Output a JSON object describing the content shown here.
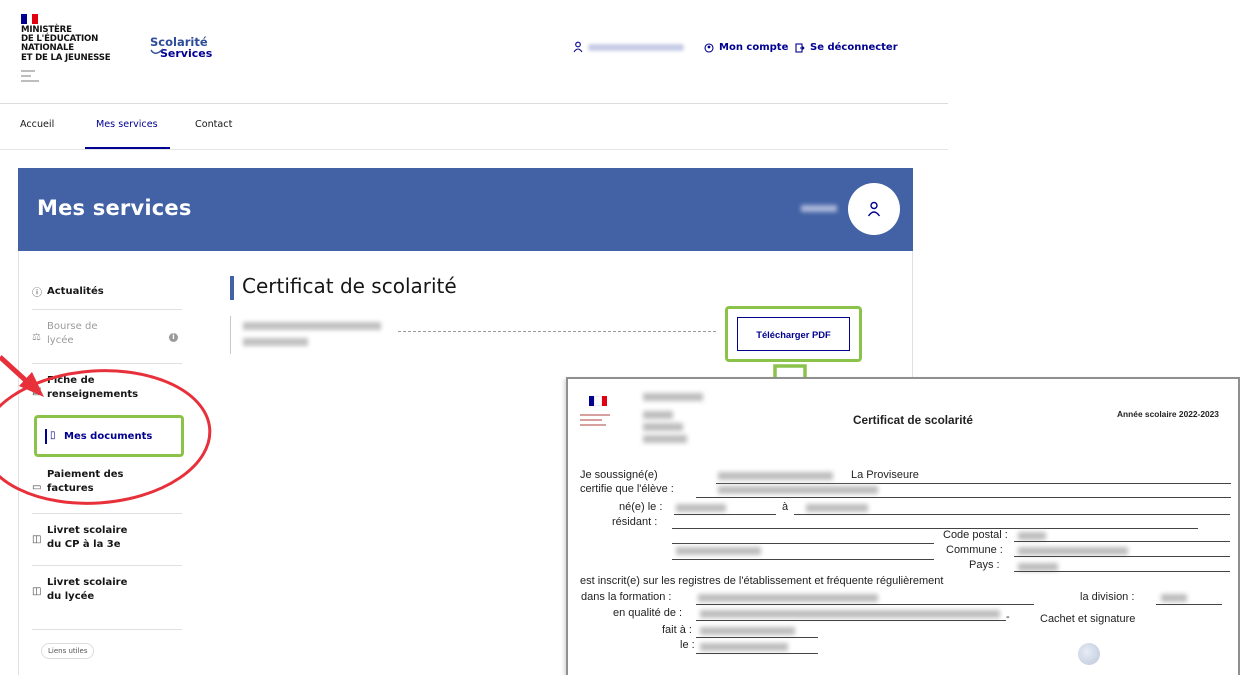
{
  "header": {
    "ministry_lines": [
      "MINISTÈRE",
      "DE L'ÉDUCATION",
      "NATIONALE",
      "ET DE LA JEUNESSE"
    ],
    "brand_top": "Scolarité",
    "brand_bottom": "Services",
    "mon_compte": "Mon compte",
    "se_deconnecter": "Se déconnecter"
  },
  "nav": {
    "items": [
      "Accueil",
      "Mes services",
      "Contact"
    ]
  },
  "banner": {
    "title": "Mes services"
  },
  "sidebar": {
    "items": [
      {
        "label": "Actualités",
        "icon": "info-icon"
      },
      {
        "label_lines": [
          "Bourse de",
          "lycée"
        ],
        "icon": "scale-icon"
      },
      {
        "label_lines": [
          "Fiche de",
          "renseignements"
        ],
        "icon": "file-icon"
      },
      {
        "label": "Mes documents",
        "icon": "document-icon"
      },
      {
        "label_lines": [
          "Paiement des",
          "factures"
        ],
        "icon": "card-icon"
      },
      {
        "label_lines": [
          "Livret scolaire",
          "du CP à la 3e"
        ],
        "icon": "book-icon"
      },
      {
        "label_lines": [
          "Livret scolaire",
          "du lycée"
        ],
        "icon": "book-icon"
      }
    ],
    "liens_utiles": "Liens utiles"
  },
  "content": {
    "title": "Certificat de scolarité",
    "download_button": "Télécharger PDF"
  },
  "certificate": {
    "title": "Certificat de scolarité",
    "annee": "Année scolaire 2022-2023",
    "je_soussigne": "Je soussigné(e)",
    "role": "La Proviseure",
    "certifie": "certifie que l'élève :",
    "ne_le": "né(e) le :",
    "a": "à",
    "residant": "résidant :",
    "code_postal": "Code postal :",
    "commune": "Commune :",
    "pays": "Pays :",
    "inscrit": "est inscrit(e) sur les registres de l'établissement et fréquente régulièrement",
    "formation": "dans la formation :",
    "division": "la division :",
    "qualite": "en qualité de :",
    "cachet": "Cachet et signature",
    "fait_a": "fait à :",
    "le": "le :"
  },
  "colors": {
    "banner": "#4262a5",
    "primary": "#000091",
    "highlight_green": "#8bc34a",
    "annotation_red": "#e8303a"
  }
}
